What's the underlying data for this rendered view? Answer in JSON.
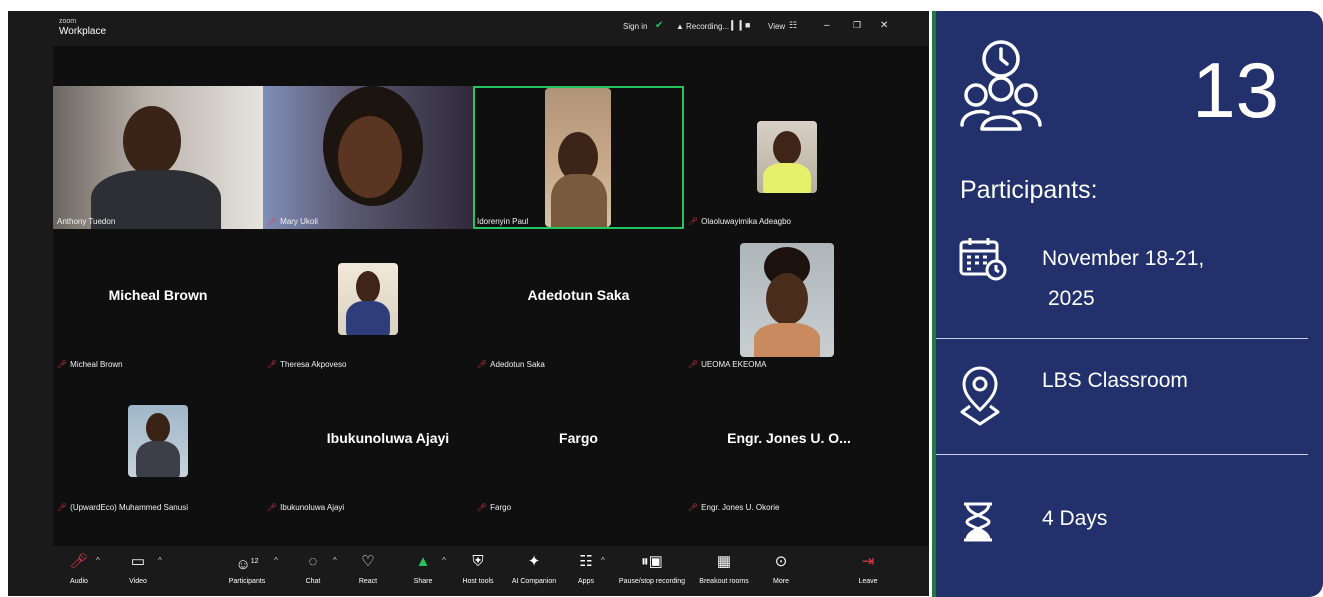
{
  "window": {
    "brand_small": "zoom",
    "brand": "Workplace",
    "sign_in": "Sign in",
    "recording": "Recording...",
    "view": "View",
    "colors": {
      "bg": "#1a1a1a",
      "active_border": "#23c45e",
      "muted_mic": "#e0384b"
    }
  },
  "participants_grid": [
    {
      "name": "Anthony Tuedon",
      "muted": false,
      "video": true
    },
    {
      "name": "Mary Ukoli",
      "muted": true,
      "video": true
    },
    {
      "name": "Idorenyin Paul",
      "muted": false,
      "video": true,
      "active": true
    },
    {
      "name": "Olaoluwayimika Adeagbo",
      "muted": true,
      "video": true
    },
    {
      "name": "Micheal Brown",
      "display": "Micheal Brown",
      "muted": true,
      "video": false
    },
    {
      "name": "Theresa Akpoveso",
      "muted": true,
      "video": true
    },
    {
      "name": "Adedotun Saka",
      "display": "Adedotun Saka",
      "muted": true,
      "video": false
    },
    {
      "name": "UEOMA EKEOMA",
      "muted": true,
      "video": true
    },
    {
      "name": "(UpwardEco) Muhammed Sanusi",
      "muted": true,
      "video": true
    },
    {
      "name": "Ibukunoluwa Ajayi",
      "display": "Ibukunoluwa Ajayi",
      "muted": true,
      "video": false
    },
    {
      "name": "Fargo",
      "display": "Fargo",
      "muted": true,
      "video": false
    },
    {
      "name": "Engr. Jones U. Okorie",
      "display": "Engr. Jones U. O...",
      "muted": true,
      "video": false
    }
  ],
  "toolbar": {
    "audio": "Audio",
    "video": "Video",
    "participants": "Participants",
    "participants_count": "12",
    "chat": "Chat",
    "react": "React",
    "share": "Share",
    "host_tools": "Host tools",
    "ai_companion": "AI Companion",
    "apps": "Apps",
    "pause_recording": "Pause/stop recording",
    "breakout_rooms": "Breakout rooms",
    "more": "More",
    "leave": "Leave"
  },
  "info_panel": {
    "count": "13",
    "participants_label": "Participants:",
    "date_line1": "November 18-21,",
    "date_line2": "2025",
    "location": "LBS Classroom",
    "duration": "4 Days",
    "colors": {
      "panel": "#22306c",
      "divider": "#1f7a3e"
    }
  }
}
